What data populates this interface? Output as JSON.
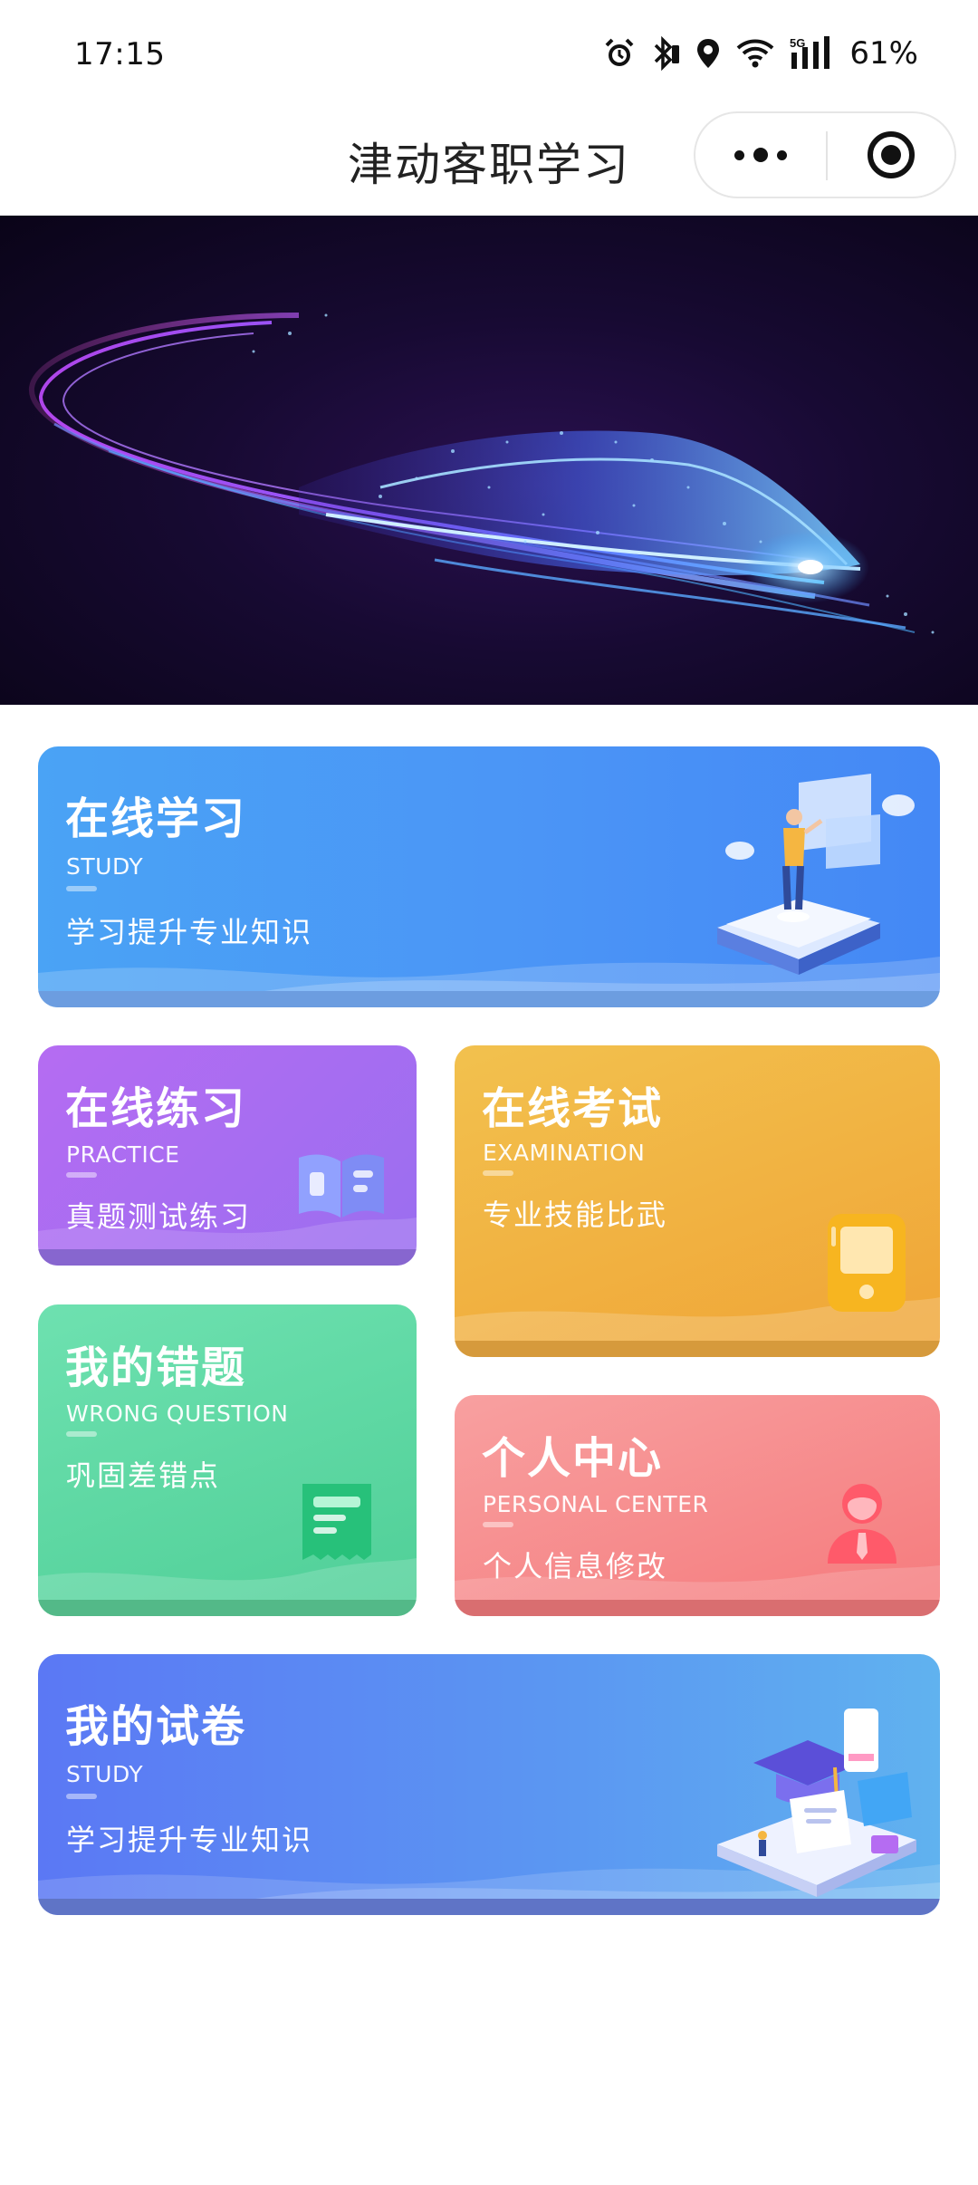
{
  "status_bar": {
    "time": "17:15",
    "battery": "61%",
    "network": "5G",
    "icons": [
      "alarm-icon",
      "bluetooth-icon",
      "location-icon",
      "wifi-icon",
      "signal-icon"
    ]
  },
  "header": {
    "title": "津动客职学习",
    "more_icon": "more-dots-icon",
    "close_icon": "target-close-icon"
  },
  "banner": {
    "image": "high-speed-train-light-trails",
    "colors": [
      "#170a32",
      "#7b2ff7",
      "#3aa8ff"
    ]
  },
  "cards": {
    "study": {
      "title": "在线学习",
      "subtitle": "STUDY",
      "desc": "学习提升专业知识",
      "color": "#4b95f6"
    },
    "practice": {
      "title": "在线练习",
      "subtitle": "PRACTICE",
      "desc": "真题测试练习",
      "color": "#a56df1"
    },
    "exam": {
      "title": "在线考试",
      "subtitle": "EXAMINATION",
      "desc": "专业技能比武",
      "color": "#f0b040"
    },
    "wrong": {
      "title": "我的错题",
      "subtitle": "WRONG QUESTION",
      "desc": "巩固差错点",
      "color": "#5fd8a3"
    },
    "personal": {
      "title": "个人中心",
      "subtitle": "PERSONAL CENTER",
      "desc": "个人信息修改",
      "color": "#f78c8d"
    },
    "papers": {
      "title": "我的试卷",
      "subtitle": "STUDY",
      "desc": "学习提升专业知识",
      "color": "#5b88f3"
    }
  }
}
